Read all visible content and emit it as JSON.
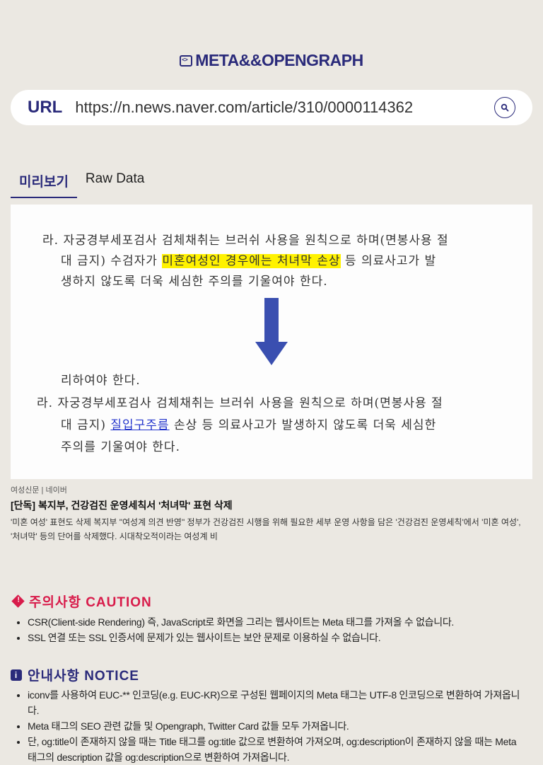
{
  "logo": {
    "text": "META&&OPENGRAPH",
    "icon": "code-icon"
  },
  "search": {
    "label": "URL",
    "value": "https://n.news.naver.com/article/310/0000114362",
    "button_icon": "search-icon"
  },
  "tabs": [
    {
      "label": "미리보기",
      "active": true
    },
    {
      "label": "Raw Data",
      "active": false
    }
  ],
  "preview_image": {
    "top_line1": "라. 자궁경부세포검사 검체채취는 브러쉬 사용을 원칙으로 하며(면봉사용 절",
    "top_line2_pre": "대 금지) 수검자가 ",
    "top_line2_hl": "미혼여성인 경우에는 처녀막 손상",
    "top_line2_post": " 등 의료사고가 발",
    "top_line3": "생하지 않도록 더욱 세심한 주의를 기울여야 한다.",
    "mid_line": "리하여야 한다.",
    "bot_line1": "라. 자궁경부세포검사 검체채취는 브러쉬 사용을 원칙으로 하며(면봉사용 절",
    "bot_line2_pre": "대 금지) ",
    "bot_line2_ul": "질입구주름",
    "bot_line2_post": " 손상 등 의료사고가 발생하지 않도록 더욱 세심한",
    "bot_line3": "주의를 기울여야 한다.",
    "arrow_color": "#3a4fb0",
    "highlight_color": "#fff200"
  },
  "meta": {
    "source": "여성신문 | 네이버",
    "title": "[단독] 복지부, 건강검진 운영세칙서 '처녀막' 표현 삭제",
    "description": "'미혼 여성' 표현도 삭제 복지부 \"여성계 의견 반영\" 정부가 건강검진 시행을 위해 필요한 세부 운영 사항을 담은 '건강검진 운영세칙'에서 '미혼 여성', '처녀막' 등의 단어를 삭제했다. 시대착오적이라는 여성계 비"
  },
  "caution": {
    "title": "주의사항 CAUTION",
    "icon": "warning-diamond-icon",
    "color": "#d81b4a",
    "items": [
      "CSR(Client-side Rendering) 즉, JavaScript로 화면을 그리는 웹사이트는 Meta 태그를 가져올 수 없습니다.",
      "SSL 연결 또는 SSL 인증서에 문제가 있는 웹사이트는 보안 문제로 이용하실 수 없습니다."
    ]
  },
  "notice": {
    "title": "안내사항 NOTICE",
    "icon": "info-icon",
    "color": "#2a2a7a",
    "items": [
      "iconv를 사용하여 EUC-** 인코딩(e.g. EUC-KR)으로 구성된 웹페이지의 Meta 태그는 UTF-8 인코딩으로 변환하여 가져옵니다.",
      "Meta 태그의 SEO 관련 값들 및 Opengraph, Twitter Card 값들 모두 가져옵니다.",
      "단, og:title이 존재하지 않을 때는 Title 태그를 og:title 값으로 변환하여 가져오며, og:description이 존재하지 않을 때는 Meta 태그의 description 값을 og:description으로 변환하여 가져옵니다."
    ]
  }
}
